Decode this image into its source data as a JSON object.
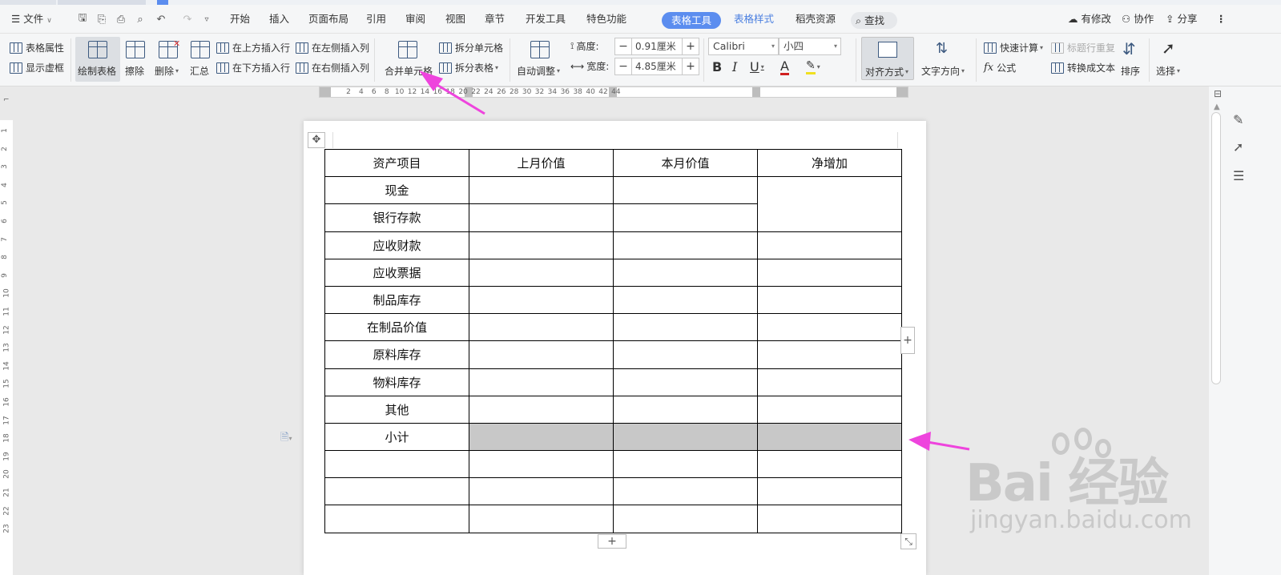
{
  "menubar": {
    "file_menu": "文件",
    "tabs": [
      "开始",
      "插入",
      "页面布局",
      "引用",
      "审阅",
      "视图",
      "章节",
      "开发工具",
      "特色功能",
      "表格工具",
      "表格样式",
      "稻壳资源"
    ],
    "active_tab": "表格工具",
    "search_label": "查找",
    "right_actions": {
      "modified": "有修改",
      "collab": "协作",
      "share": "分享"
    }
  },
  "ribbon": {
    "table_props": "表格属性",
    "show_gridlines": "显示虚框",
    "draw_table": "绘制表格",
    "erase": "擦除",
    "delete": "删除",
    "summary": "汇总",
    "insert_row_above": "在上方插入行",
    "insert_row_below": "在下方插入行",
    "insert_col_left": "在左侧插入列",
    "insert_col_right": "在右侧插入列",
    "merge_cells": "合并单元格",
    "split_cells": "拆分单元格",
    "split_table": "拆分表格",
    "auto_fit": "自动调整",
    "height_label": "高度:",
    "height_value": "0.91厘米",
    "width_label": "宽度:",
    "width_value": "4.85厘米",
    "font_name": "Calibri",
    "font_size": "小四",
    "bold": "B",
    "italic": "I",
    "underline": "U",
    "font_color": "A",
    "align": "对齐方式",
    "text_direction": "文字方向",
    "quick_calc": "快速计算",
    "repeat_header": "标题行重复",
    "formula": "公式",
    "to_text": "转换成文本",
    "sort": "排序",
    "select": "选择"
  },
  "ruler": {
    "h_ticks": [
      "2",
      "4",
      "6",
      "8",
      "10",
      "12",
      "14",
      "16",
      "18",
      "20",
      "22",
      "24",
      "26",
      "28",
      "30",
      "32",
      "34",
      "36",
      "38",
      "40",
      "42",
      "44"
    ],
    "v_ticks": [
      "1",
      "2",
      "3",
      "4",
      "5",
      "6",
      "7",
      "8",
      "9",
      "10",
      "11",
      "12",
      "13",
      "14",
      "15",
      "16",
      "17",
      "18",
      "19",
      "20",
      "21",
      "22",
      "23"
    ]
  },
  "table": {
    "headers": [
      "资产项目",
      "上月价值",
      "本月价值",
      "净增加"
    ],
    "rows": [
      [
        "现金",
        "",
        "",
        ""
      ],
      [
        "银行存款",
        "",
        "",
        ""
      ],
      [
        "应收财款",
        "",
        "",
        ""
      ],
      [
        "应收票据",
        "",
        "",
        ""
      ],
      [
        "制品库存",
        "",
        "",
        ""
      ],
      [
        "在制品价值",
        "",
        "",
        ""
      ],
      [
        "原料库存",
        "",
        "",
        ""
      ],
      [
        "物料库存",
        "",
        "",
        ""
      ],
      [
        "其他",
        "",
        "",
        ""
      ],
      [
        "小计",
        "",
        "",
        ""
      ],
      [
        "",
        "",
        "",
        ""
      ],
      [
        "",
        "",
        "",
        ""
      ],
      [
        "",
        "",
        "",
        ""
      ]
    ]
  },
  "watermark": {
    "brand": "Bai  经验",
    "url": "jingyan.baidu.com"
  },
  "colors": {
    "accent": "#5b8def",
    "arrow": "#ee44dd",
    "selection": "#c8c8c8"
  }
}
